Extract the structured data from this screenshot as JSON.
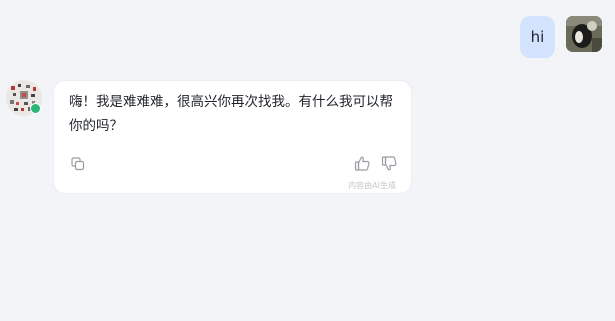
{
  "user_message": {
    "text": "hi",
    "bubble_color": "#d3e3fd",
    "avatar": "user-avatar-photo"
  },
  "bot_message": {
    "text": "嗨！我是难难难，很高兴你再次找我。有什么我可以帮你的吗？",
    "avatar": "bot-avatar-image",
    "status_color": "#2bb673",
    "footer_note": "内容由AI生成",
    "actions": {
      "copy": "copy-icon",
      "like": "thumbs-up-icon",
      "dislike": "thumbs-down-icon"
    }
  },
  "colors": {
    "page_background": "#f3f4f8",
    "bubble_background": "#ffffff",
    "text": "#1f2329",
    "icon": "#9a9ca2"
  }
}
